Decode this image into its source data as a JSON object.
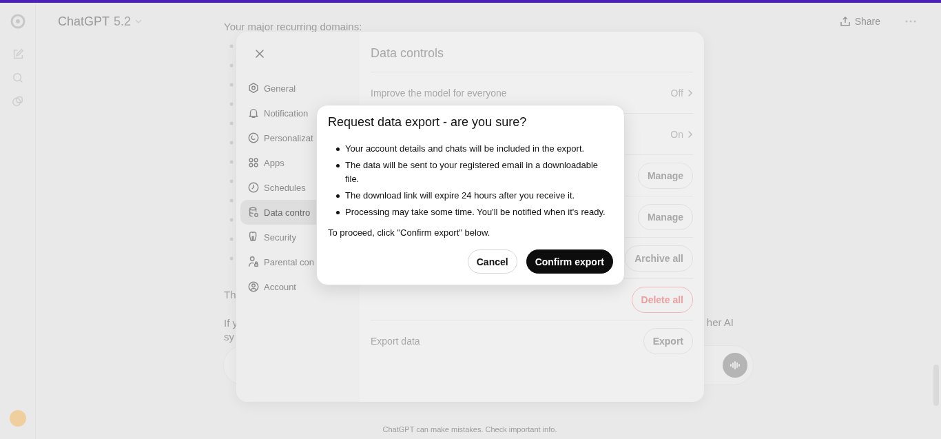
{
  "header": {
    "title": "ChatGPT",
    "version": "5.2",
    "share": "Share"
  },
  "chat": {
    "heading": "Your major recurring domains:",
    "fragments": [
      "Th",
      "If y",
      "her AI",
      "sy"
    ]
  },
  "footer": "ChatGPT can make mistakes. Check important info.",
  "settings": {
    "nav": [
      {
        "label": "General",
        "selected": false
      },
      {
        "label": "Notification",
        "selected": false
      },
      {
        "label": "Personalizat",
        "selected": false
      },
      {
        "label": "Apps",
        "selected": false
      },
      {
        "label": "Schedules",
        "selected": false
      },
      {
        "label": "Data contro",
        "selected": true
      },
      {
        "label": "Security",
        "selected": false
      },
      {
        "label": "Parental con",
        "selected": false
      },
      {
        "label": "Account",
        "selected": false
      }
    ],
    "title": "Data controls",
    "rows": [
      {
        "kind": "setting",
        "label": "Improve the model for everyone",
        "value": "Off"
      },
      {
        "kind": "setting",
        "value": "On"
      },
      {
        "kind": "action",
        "action": "Manage",
        "danger": false
      },
      {
        "kind": "action",
        "action": "Manage",
        "danger": false
      },
      {
        "kind": "action",
        "action": "Archive all",
        "danger": false
      },
      {
        "kind": "action",
        "action": "Delete all",
        "danger": true
      },
      {
        "kind": "action",
        "label": "Export data",
        "action": "Export",
        "danger": false
      }
    ]
  },
  "dialog": {
    "title": "Request data export - are you sure?",
    "bullets": [
      "Your account details and chats will be included in the export.",
      "The data will be sent to your registered email in a downloadable file.",
      "The download link will expire 24 hours after you receive it.",
      "Processing may take some time. You'll be notified when it's ready."
    ],
    "note": "To proceed, click \"Confirm export\" below.",
    "buttons": [
      {
        "label": "Cancel",
        "kind": "secondary"
      },
      {
        "label": "Confirm export",
        "kind": "primary"
      }
    ]
  }
}
